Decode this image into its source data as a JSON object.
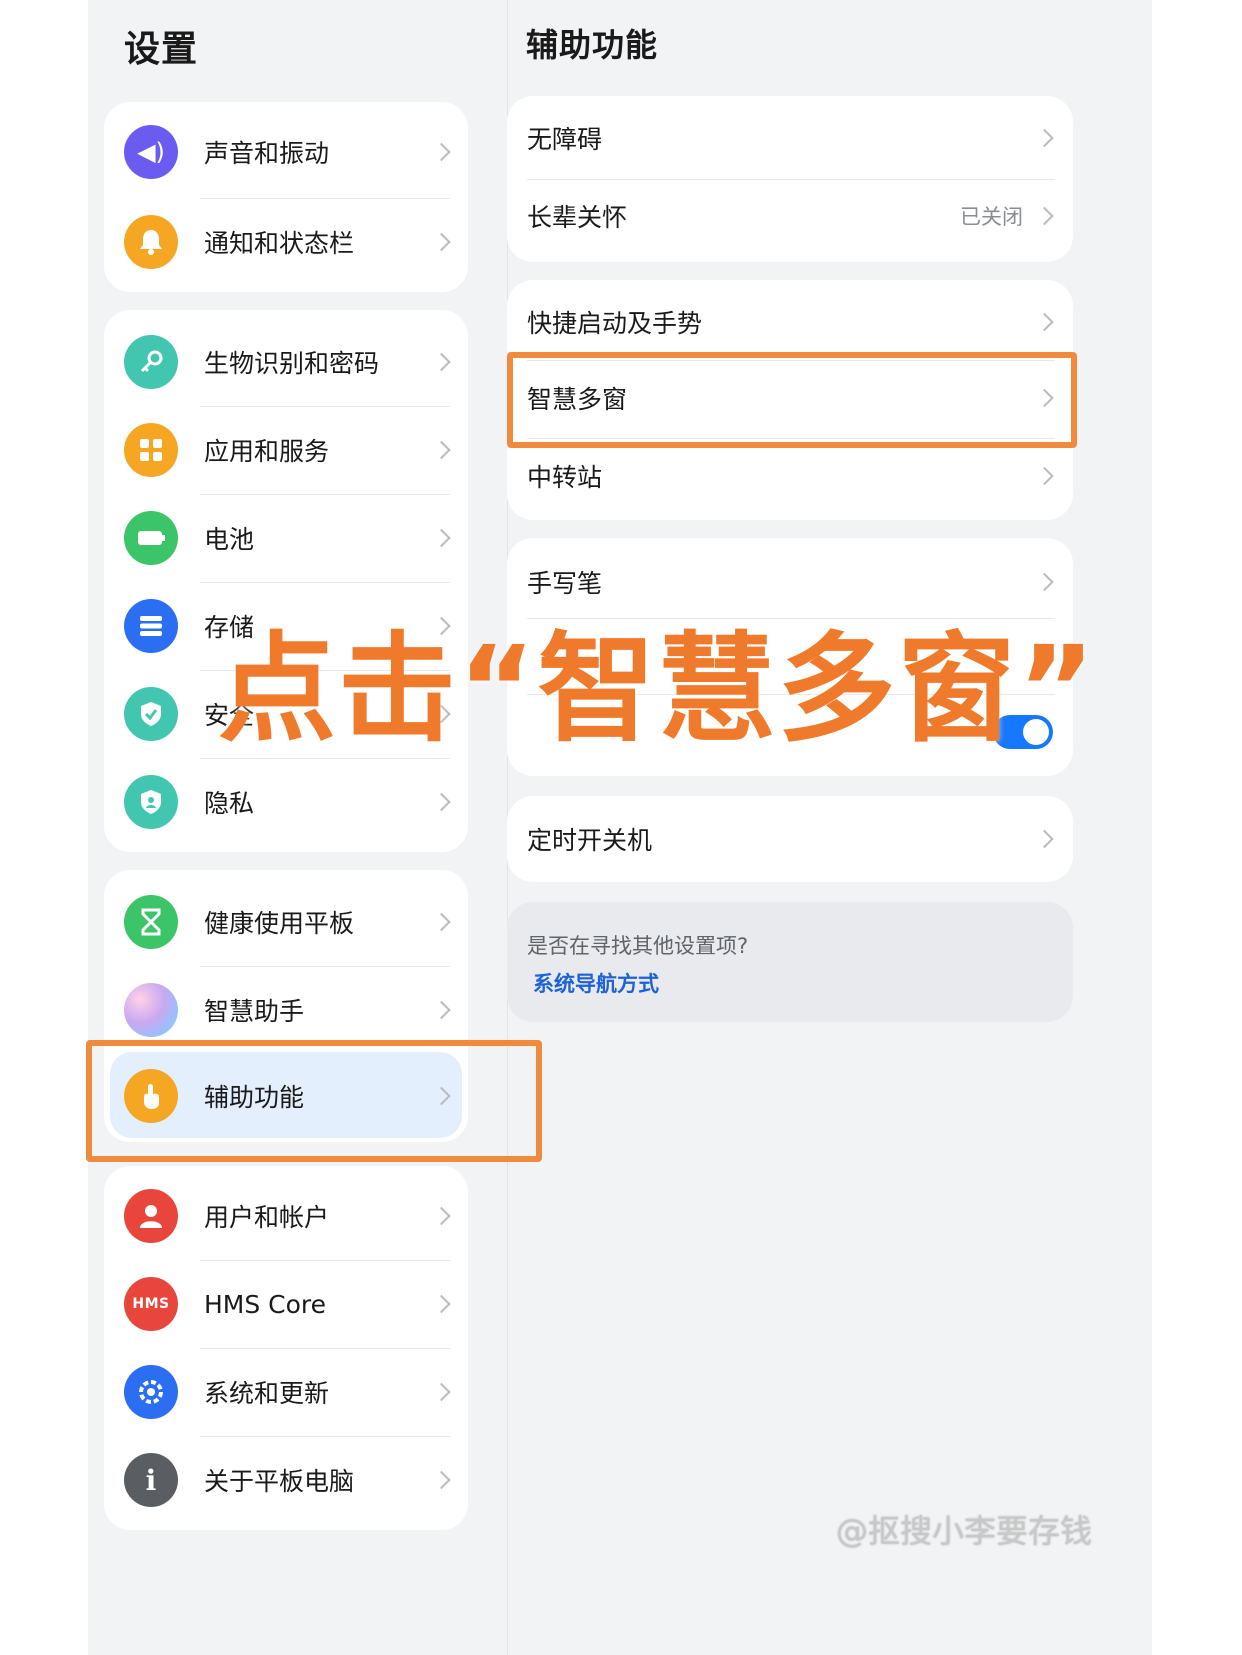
{
  "left_pane": {
    "title": "设置",
    "groups": [
      {
        "items": [
          {
            "label": "声音和振动",
            "icon": "sound-icon",
            "color": "#6a5cf0",
            "glyph": "🔊"
          },
          {
            "label": "通知和状态栏",
            "icon": "bell-icon",
            "color": "#f5a623",
            "glyph": "🔔"
          }
        ]
      },
      {
        "items": [
          {
            "label": "生物识别和密码",
            "icon": "key-icon",
            "color": "#43c6b0",
            "glyph": "⚷"
          },
          {
            "label": "应用和服务",
            "icon": "apps-icon",
            "color": "#f5a623",
            "glyph": "▦"
          },
          {
            "label": "电池",
            "icon": "battery-icon",
            "color": "#3bc468",
            "glyph": "▭"
          },
          {
            "label": "存储",
            "icon": "storage-icon",
            "color": "#2b6ef2",
            "glyph": "≡"
          },
          {
            "label": "安全",
            "icon": "shield-check-icon",
            "color": "#43c6b0",
            "glyph": "✓"
          },
          {
            "label": "隐私",
            "icon": "privacy-icon",
            "color": "#43c6b0",
            "glyph": "⛉"
          }
        ]
      },
      {
        "items": [
          {
            "label": "健康使用平板",
            "icon": "hourglass-icon",
            "color": "#3bc468",
            "glyph": "⧗"
          },
          {
            "label": "智慧助手",
            "icon": "assistant-icon",
            "color": "#c9a8f0",
            "glyph": ""
          },
          {
            "label": "辅助功能",
            "icon": "hand-icon",
            "color": "#f5a623",
            "glyph": "☝",
            "selected": true
          }
        ]
      },
      {
        "items": [
          {
            "label": "用户和帐户",
            "icon": "user-icon",
            "color": "#e8453c",
            "glyph": "👤"
          },
          {
            "label": "HMS Core",
            "icon": "hms-icon",
            "color": "#e8453c",
            "glyph": "HMS"
          },
          {
            "label": "系统和更新",
            "icon": "system-gear-icon",
            "color": "#2b6ef2",
            "glyph": "⚙"
          },
          {
            "label": "关于平板电脑",
            "icon": "info-icon",
            "color": "#5a5d62",
            "glyph": "i"
          }
        ]
      }
    ]
  },
  "right_pane": {
    "title": "辅助功能",
    "groups": [
      {
        "items": [
          {
            "label": "无障碍"
          },
          {
            "label": "长辈关怀",
            "value": "已关闭"
          }
        ]
      },
      {
        "items": [
          {
            "label": "快捷启动及手势"
          },
          {
            "label": "智慧多窗"
          },
          {
            "label": "中转站"
          }
        ]
      },
      {
        "items": [
          {
            "label": "手写笔"
          },
          {
            "label": ""
          },
          {
            "label": "",
            "toggle": true
          }
        ]
      },
      {
        "items": [
          {
            "label": "定时开关机"
          }
        ]
      }
    ],
    "hint": {
      "question": "是否在寻找其他设置项?",
      "link": "系统导航方式"
    }
  },
  "overlay": {
    "caption": "点击“智慧多窗”",
    "accent_color": "#f07a2c"
  },
  "watermark": "@抠搜小李要存钱"
}
